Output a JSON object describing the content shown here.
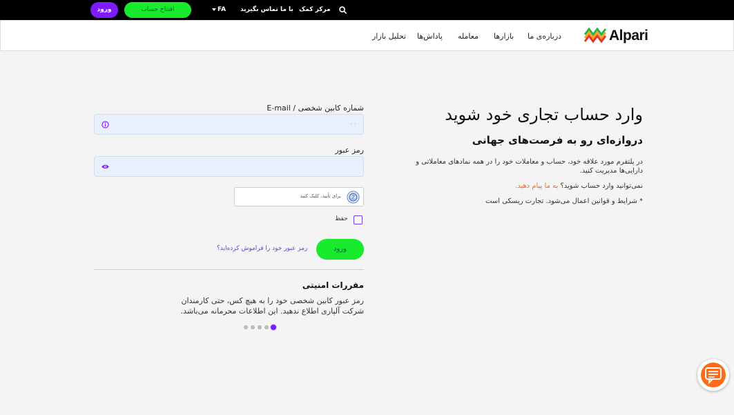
{
  "topbar": {
    "login_label": "ورود",
    "open_account_label": "افتتاح حساب",
    "language": "FA",
    "contact_label": "با ما تماس بگیرید",
    "help_label": "مرکز کمک"
  },
  "nav": {
    "logo_text": "Alpari",
    "items": [
      "درباره‌ی ما",
      "بازارها",
      "معامله",
      "پاداش‌ها",
      "تحلیل بازار"
    ]
  },
  "intro": {
    "title": "وارد حساب تجاری خود شوید",
    "subtitle": "دروازه‌ای رو به فرصت‌های جهانی",
    "description": "در پلتفرم مورد علاقه خود، حساب و معاملات خود را در همه نمادهای معاملاتی و دارایی‌ها مدیریت کنید.",
    "cant_login": "نمی‌توانید وارد حساب شوید؟",
    "message_us": "به ما پیام دهید.",
    "terms": "* شرایط و قوانین اعمال می‌شود. تجارت ریسکی است"
  },
  "form": {
    "account_label": "شماره کابین شخصی / E-mail",
    "account_value": "· ·",
    "password_label": "رمز عبور",
    "captcha_text": "برای تأیید، کلیک کنید",
    "remember_label": "حفظ",
    "login_button": "ورود",
    "forgot_link": "رمز عبور خود را فراموش کرده‌اید؟"
  },
  "security": {
    "title": "مقررات امنیتی",
    "text": "رمز عبور کابین شخصی خود را به هیچ کس، حتی کارمندان شرکت آلپاری اطلاع ندهید. این اطلاعات محرمانه می‌باشد."
  },
  "carousel": {
    "count": 5,
    "active_index": 4
  },
  "colors": {
    "purple": "#7c1cff",
    "green": "#1aea2e",
    "orange": "#ff6b1a"
  }
}
